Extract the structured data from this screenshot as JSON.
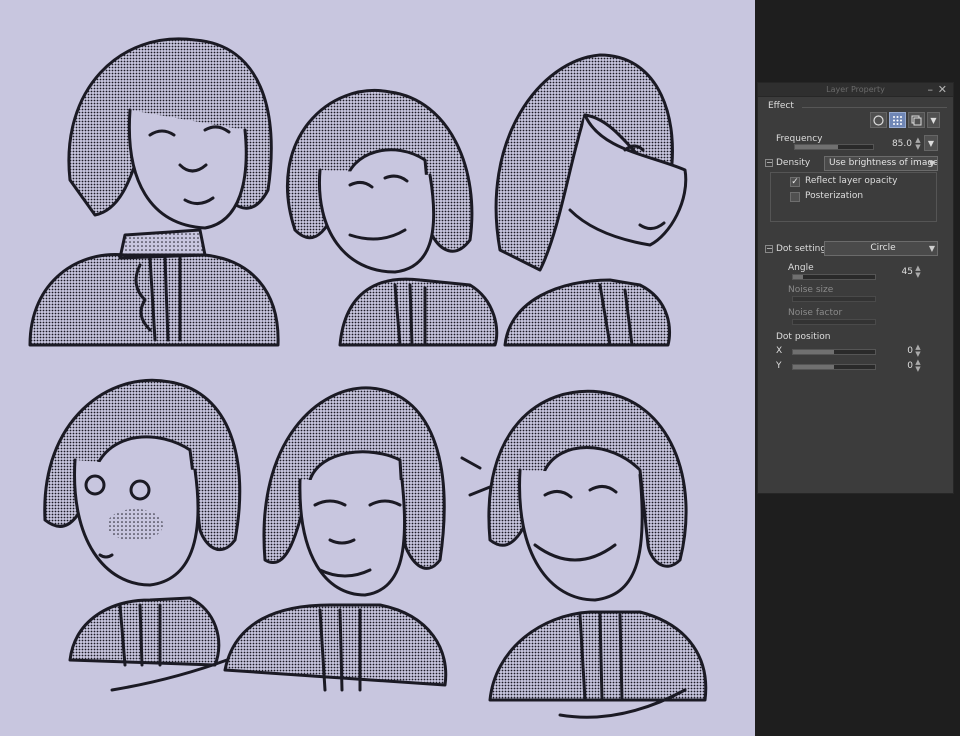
{
  "panel": {
    "title": "Layer Property",
    "effect_label": "Effect",
    "frequency": {
      "label": "Frequency",
      "value": "85.0",
      "fill": 0.55
    },
    "density": {
      "label": "Density",
      "mode": "Use brightness of image"
    },
    "reflect_layer_opacity": {
      "label": "Reflect layer opacity",
      "checked": true
    },
    "posterization": {
      "label": "Posterization",
      "checked": false
    },
    "dot_settings": {
      "label": "Dot settings",
      "shape": "Circle"
    },
    "angle": {
      "label": "Angle",
      "value": "45",
      "fill": 0.12
    },
    "noise_size": {
      "label": "Noise size"
    },
    "noise_factor": {
      "label": "Noise factor"
    },
    "dot_position": {
      "label": "Dot position",
      "x": {
        "label": "X",
        "value": "0",
        "fill": 0.5
      },
      "y": {
        "label": "Y",
        "value": "0",
        "fill": 0.5
      }
    }
  },
  "colors": {
    "canvas_bg": "#c8c6df",
    "panel_bg": "#3c3c3c",
    "accent": "#6f86b5",
    "ink": "#1b1a24"
  },
  "icons": [
    "circle-effect-icon",
    "tone-effect-icon",
    "layer-effect-icon",
    "chevron-down-icon",
    "close-icon",
    "minimize-icon",
    "checkmark-icon"
  ]
}
